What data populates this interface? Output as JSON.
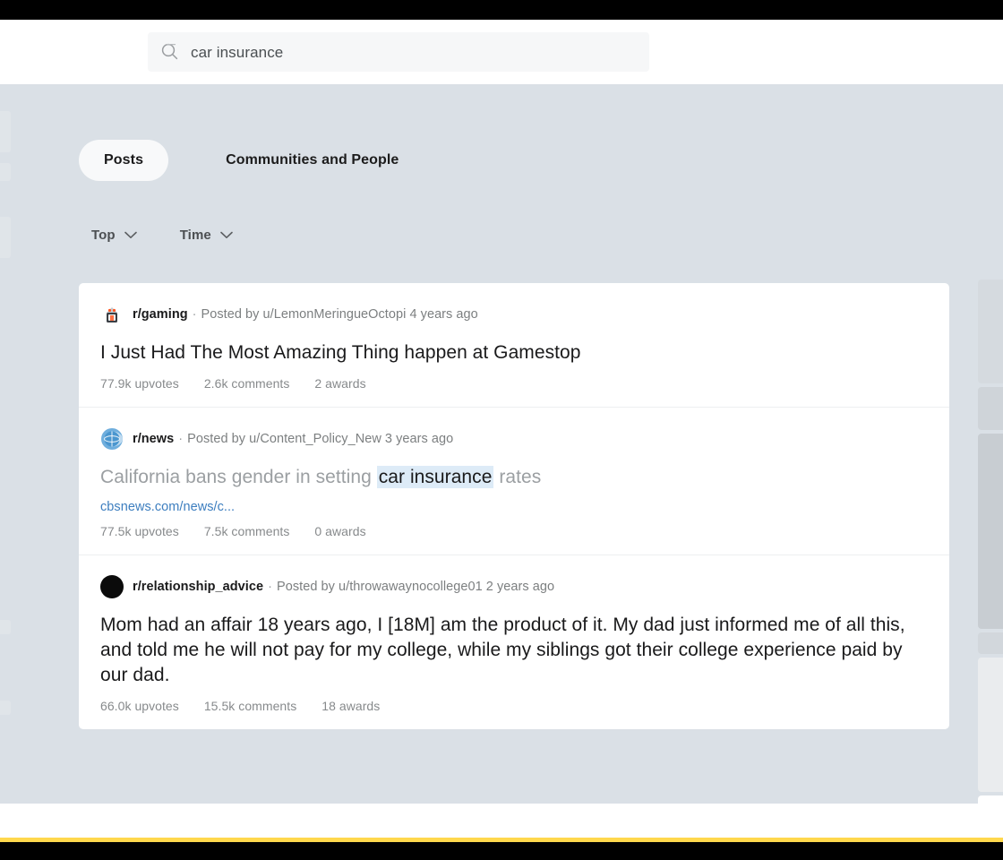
{
  "search": {
    "value": "car insurance",
    "icon": "search-icon"
  },
  "tabs": [
    {
      "label": "Posts",
      "active": true
    },
    {
      "label": "Communities and People",
      "active": false
    }
  ],
  "sort": [
    {
      "label": "Top",
      "icon": "chevron-down-icon"
    },
    {
      "label": "Time",
      "icon": "chevron-down-icon"
    }
  ],
  "posts": [
    {
      "subreddit": "r/gaming",
      "separator": "·",
      "posted_by": "Posted by u/LemonMeringueOctopi 4 years ago",
      "avatar_icon": "gaming-snoo-avatar-icon",
      "title": "I Just Had The Most Amazing Thing happen at Gamestop",
      "title_visited": false,
      "url": "",
      "upvotes": "77.9k upvotes",
      "comments": "2.6k comments",
      "awards": "2 awards"
    },
    {
      "subreddit": "r/news",
      "separator": "·",
      "posted_by": "Posted by u/Content_Policy_New 3 years ago",
      "avatar_icon": "news-globe-avatar-icon",
      "title_before": "California bans gender in setting ",
      "title_highlight": "car insurance",
      "title_after": " rates",
      "title_visited": true,
      "url": "cbsnews.com/news/c...",
      "upvotes": "77.5k upvotes",
      "comments": "7.5k comments",
      "awards": "0 awards"
    },
    {
      "subreddit": "r/relationship_advice",
      "separator": "·",
      "posted_by": "Posted by u/throwawaynocollege01 2 years ago",
      "avatar_icon": "black-circle-avatar-icon",
      "title": "Mom had an affair 18 years ago, I [18M] am the product of it. My dad just informed me of all this, and told me he will not pay for my college, while my siblings got their college experience paid by our dad.",
      "title_visited": false,
      "url": "",
      "upvotes": "66.0k upvotes",
      "comments": "15.5k comments",
      "awards": "18 awards"
    }
  ],
  "colors": {
    "page_background": "#dae0e6",
    "card_background": "#ffffff",
    "highlight": "#ddebf7",
    "link": "#3d7ebf",
    "accent_line": "#ffd84d",
    "muted_text": "#878a8c"
  }
}
